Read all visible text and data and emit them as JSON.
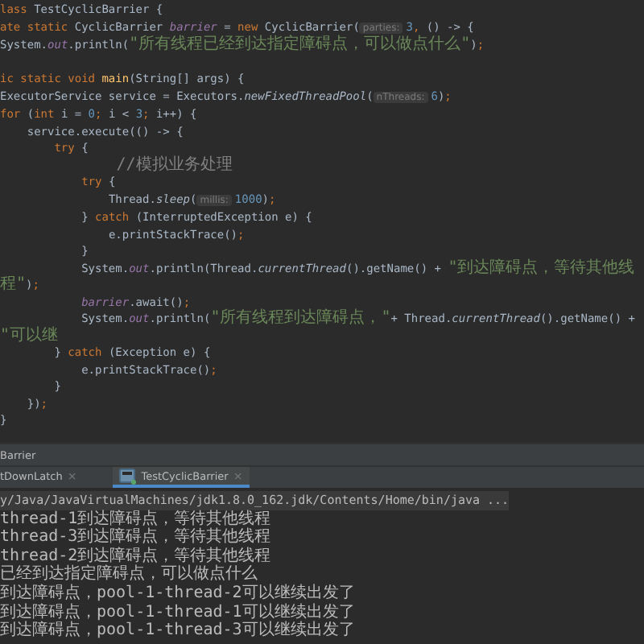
{
  "editor": {
    "lines": [
      {
        "tokens": [
          {
            "kind": "kw",
            "text": "lass "
          },
          {
            "kind": "plain",
            "text": "TestCyclicBarrier {"
          }
        ]
      },
      {
        "tokens": [
          {
            "kind": "kw",
            "text": "ate static "
          },
          {
            "kind": "plain",
            "text": "CyclicBarrier "
          },
          {
            "kind": "field",
            "text": "barrier"
          },
          {
            "kind": "plain",
            "text": " = "
          },
          {
            "kind": "kw",
            "text": "new "
          },
          {
            "kind": "plain",
            "text": "CyclicBarrier("
          },
          {
            "kind": "hint",
            "text": "parties:"
          },
          {
            "kind": "num",
            "text": "3"
          },
          {
            "kind": "kw",
            "text": ", "
          },
          {
            "kind": "plain",
            "text": "() -> {"
          }
        ]
      },
      {
        "tokens": [
          {
            "kind": "plain",
            "text": "System."
          },
          {
            "kind": "field",
            "text": "out"
          },
          {
            "kind": "plain",
            "text": ".println("
          },
          {
            "kind": "str",
            "text": "\"所有线程已经到达指定障碍点，可以做点什么\""
          },
          {
            "kind": "plain",
            "text": ")"
          },
          {
            "kind": "kw",
            "text": ";"
          }
        ]
      },
      {
        "kind": "blank"
      },
      {
        "tokens": [
          {
            "kind": "kw",
            "text": "ic static void "
          },
          {
            "kind": "method",
            "text": "main"
          },
          {
            "kind": "plain",
            "text": "(String[] args) {"
          }
        ]
      },
      {
        "tokens": [
          {
            "kind": "plain",
            "text": "ExecutorService service = Executors."
          },
          {
            "kind": "static",
            "text": "newFixedThreadPool"
          },
          {
            "kind": "plain",
            "text": "("
          },
          {
            "kind": "hint",
            "text": "nThreads:"
          },
          {
            "kind": "num",
            "text": "6"
          },
          {
            "kind": "plain",
            "text": ")"
          },
          {
            "kind": "kw",
            "text": ";"
          }
        ]
      },
      {
        "tokens": [
          {
            "kind": "kw",
            "text": "for "
          },
          {
            "kind": "plain",
            "text": "("
          },
          {
            "kind": "kw",
            "text": "int "
          },
          {
            "kind": "plain",
            "text": "i = "
          },
          {
            "kind": "num",
            "text": "0"
          },
          {
            "kind": "kw",
            "text": "; "
          },
          {
            "kind": "plain",
            "text": "i < "
          },
          {
            "kind": "num",
            "text": "3"
          },
          {
            "kind": "kw",
            "text": "; "
          },
          {
            "kind": "plain",
            "text": "i++) {"
          }
        ]
      },
      {
        "tokens": [
          {
            "kind": "plain",
            "text": "    service.execute(() -> {"
          }
        ]
      },
      {
        "tokens": [
          {
            "kind": "kw",
            "text": "        try "
          },
          {
            "kind": "plain",
            "text": "{"
          }
        ]
      },
      {
        "tokens": [
          {
            "kind": "comment",
            "text": "            //模拟业务处理"
          }
        ]
      },
      {
        "tokens": [
          {
            "kind": "kw",
            "text": "            try "
          },
          {
            "kind": "plain",
            "text": "{"
          }
        ]
      },
      {
        "tokens": [
          {
            "kind": "plain",
            "text": "                Thread."
          },
          {
            "kind": "static",
            "text": "sleep"
          },
          {
            "kind": "plain",
            "text": "("
          },
          {
            "kind": "hint",
            "text": "millis:"
          },
          {
            "kind": "num",
            "text": "1000"
          },
          {
            "kind": "plain",
            "text": ")"
          },
          {
            "kind": "kw",
            "text": ";"
          }
        ]
      },
      {
        "tokens": [
          {
            "kind": "plain",
            "text": "            } "
          },
          {
            "kind": "kw",
            "text": "catch "
          },
          {
            "kind": "plain",
            "text": "(InterruptedException e) {"
          }
        ]
      },
      {
        "tokens": [
          {
            "kind": "plain",
            "text": "                e.printStackTrace()"
          },
          {
            "kind": "kw",
            "text": ";"
          }
        ]
      },
      {
        "tokens": [
          {
            "kind": "plain",
            "text": "            }"
          }
        ]
      },
      {
        "tokens": [
          {
            "kind": "plain",
            "text": "            System."
          },
          {
            "kind": "field",
            "text": "out"
          },
          {
            "kind": "plain",
            "text": ".println(Thread."
          },
          {
            "kind": "static",
            "text": "currentThread"
          },
          {
            "kind": "plain",
            "text": "().getName() + "
          },
          {
            "kind": "str",
            "text": "\"到达障碍点，等待其他线程\""
          },
          {
            "kind": "plain",
            "text": ")"
          },
          {
            "kind": "kw",
            "text": ";"
          }
        ]
      },
      {
        "tokens": [
          {
            "kind": "field",
            "text": "            barrier"
          },
          {
            "kind": "plain",
            "text": ".await()"
          },
          {
            "kind": "kw",
            "text": ";"
          }
        ]
      },
      {
        "tokens": [
          {
            "kind": "plain",
            "text": "            System."
          },
          {
            "kind": "field",
            "text": "out"
          },
          {
            "kind": "plain",
            "text": ".println("
          },
          {
            "kind": "str",
            "text": "\"所有线程到达障碍点，\""
          },
          {
            "kind": "plain",
            "text": "+ Thread."
          },
          {
            "kind": "static",
            "text": "currentThread"
          },
          {
            "kind": "plain",
            "text": "().getName() + "
          },
          {
            "kind": "str",
            "text": "\"可以继"
          }
        ]
      },
      {
        "tokens": [
          {
            "kind": "plain",
            "text": "        } "
          },
          {
            "kind": "kw",
            "text": "catch "
          },
          {
            "kind": "plain",
            "text": "(Exception e) {"
          }
        ]
      },
      {
        "tokens": [
          {
            "kind": "plain",
            "text": "            e.printStackTrace()"
          },
          {
            "kind": "kw",
            "text": ";"
          }
        ]
      },
      {
        "tokens": [
          {
            "kind": "plain",
            "text": "        }"
          }
        ]
      },
      {
        "tokens": [
          {
            "kind": "plain",
            "text": "    })"
          },
          {
            "kind": "kw",
            "text": ";"
          }
        ]
      },
      {
        "tokens": [
          {
            "kind": "plain",
            "text": "}"
          }
        ]
      }
    ]
  },
  "run_panel": {
    "title": "Barrier",
    "tabs": [
      {
        "label": "tDownLatch",
        "close": "×",
        "selected": false
      },
      {
        "label": "TestCyclicBarrier",
        "close": "×",
        "selected": true
      }
    ],
    "console": [
      {
        "kind": "command",
        "text": "y/Java/JavaVirtualMachines/jdk1.8.0_162.jdk/Contents/Home/bin/java ..."
      },
      {
        "kind": "output",
        "text": "thread-1到达障碍点，等待其他线程"
      },
      {
        "kind": "output",
        "text": "thread-3到达障碍点，等待其他线程"
      },
      {
        "kind": "output",
        "text": "thread-2到达障碍点，等待其他线程"
      },
      {
        "kind": "output",
        "text": "已经到达指定障碍点，可以做点什么"
      },
      {
        "kind": "output",
        "text": "到达障碍点，pool-1-thread-2可以继续出发了"
      },
      {
        "kind": "output",
        "text": "到达障碍点，pool-1-thread-1可以继续出发了"
      },
      {
        "kind": "output",
        "text": "到达障碍点，pool-1-thread-3可以继续出发了"
      }
    ]
  }
}
